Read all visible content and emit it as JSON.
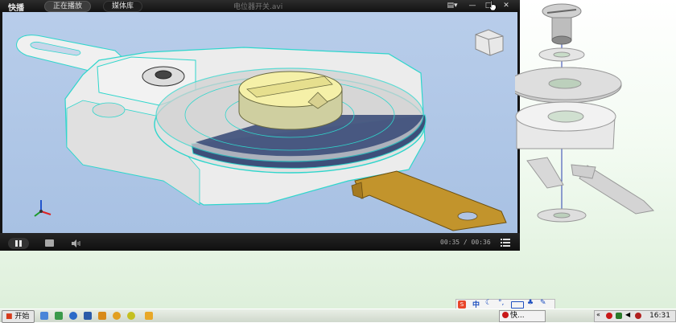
{
  "player": {
    "logo": "快播",
    "tabs": [
      {
        "label": "正在播放"
      },
      {
        "label": "媒体库"
      }
    ],
    "video_title": "电位器开关.avi",
    "controls": {
      "time_current": "00:35",
      "time_separator": " / ",
      "time_total": "00:36",
      "progress_fraction": 0.97
    }
  },
  "taskbar": {
    "start_label": "开始",
    "ime_label": "中",
    "task_label": "快...",
    "clock": "16:31"
  },
  "colors": {
    "viewport_bg": "#b0c7e6",
    "part_gray": "#e6e6e6",
    "part_gold": "#c2942c",
    "knob_yellow": "#f5f0a8",
    "disc_blue": "#3d4f7a",
    "edge_cyan": "#2fd6cc"
  }
}
